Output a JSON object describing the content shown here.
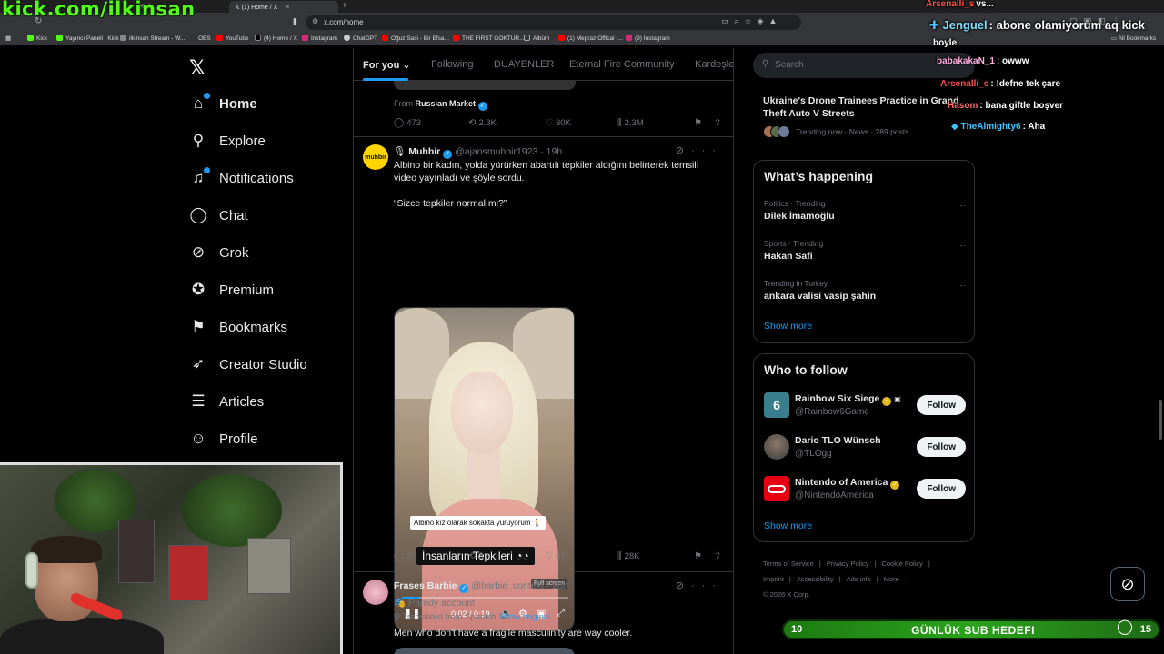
{
  "stream": {
    "banner": "kick.com/ilkinsan",
    "chat": [
      {
        "user": "Arsenalli_s",
        "message": "vs...",
        "color": "#ff4d4d"
      },
      {
        "user": "Jenguel",
        "message": "abone olamiyorum aq kick",
        "color": "#7fe0ff"
      },
      {
        "user": "",
        "message": "boyle",
        "color": "#ffffff"
      },
      {
        "user": "babakakaN_1",
        "message": "owww",
        "color": "#ffb0e0"
      },
      {
        "user": "Arsenalli_s",
        "message": "!defne tek çare",
        "color": "#ff4d4d"
      },
      {
        "user": "Hasom",
        "message": "bana giftle boşver",
        "color": "#ff6b6b"
      },
      {
        "user": "TheAlmighty6",
        "message": "Aha",
        "color": "#3fc6ff"
      }
    ],
    "goal": {
      "left": "10",
      "label": "GÜNLÜK SUB HEDEFI",
      "right": "15",
      "progress": 0.67
    }
  },
  "browser": {
    "tabs": [
      {
        "label": "Kick",
        "active": false
      },
      {
        "label": "(1) Home / X",
        "active": true
      }
    ],
    "url": "x.com/home",
    "bookmarks": [
      "Kick",
      "Yayıncı Paneli | Kick",
      "ilkinsan Stream - W...",
      "OBS",
      "YouTube",
      "(4) Home / X",
      "Instagram",
      "ChatGPT",
      "Oğuz Sasi - Bir Efsa...",
      "THE FIRST GOKTUR...",
      "Albüm",
      "(1) Mepraz Offical -...",
      "(9) Instagram"
    ],
    "all_bookmarks": "All Bookmarks"
  },
  "nav": {
    "items": [
      {
        "label": "Home",
        "icon": "home-icon"
      },
      {
        "label": "Explore",
        "icon": "search-icon"
      },
      {
        "label": "Notifications",
        "icon": "bell-icon"
      },
      {
        "label": "Chat",
        "icon": "chat-icon"
      },
      {
        "label": "Grok",
        "icon": "grok-icon"
      },
      {
        "label": "Premium",
        "icon": "verified-badge-icon"
      },
      {
        "label": "Bookmarks",
        "icon": "bookmark-icon"
      },
      {
        "label": "Creator Studio",
        "icon": "rocket-icon"
      },
      {
        "label": "Articles",
        "icon": "articles-icon"
      },
      {
        "label": "Profile",
        "icon": "person-icon"
      }
    ]
  },
  "timeline": {
    "tabs": [
      "For you",
      "Following",
      "DUAYENLER",
      "Eternal Fire Community",
      "Kardeşle"
    ],
    "prev_post": {
      "from_label": "From",
      "from_name": "Russian Market",
      "actions": {
        "replies": "473",
        "reposts": "2.3K",
        "likes": "30K",
        "views": "2.3M"
      }
    },
    "post1": {
      "name": "Muhbir",
      "handle": "@ajansmuhbir1923",
      "time": "19h",
      "avatar_text": "muhbir",
      "text1": "Albino bir kadın, yolda yürürken abartılı tepkiler aldığını belirterek temsili video yayınladı ve şöyle sordu.",
      "text2": "“Sizce tepkiler normal mi?”",
      "video": {
        "caption1": "Albino kız olarak sokakta yürüyorum",
        "caption2": "İnsanların Tepkileri",
        "fullscreen_tip": "Full screen",
        "time": "0:02 / 0:19",
        "progress": 0.105
      },
      "actions": {
        "replies": "37",
        "reposts": "3",
        "likes": "37",
        "views": "28K"
      }
    },
    "post2": {
      "name": "Frases Barbie",
      "handle": "@barbie_context",
      "time": "20h",
      "parody": "Parody account",
      "translated": "Translated from Spanish",
      "show_original": "Show original",
      "text": "Men who don't have a fragile masculinity are way cooler."
    }
  },
  "sidebar": {
    "search_placeholder": "Search",
    "top_trend": {
      "title": "Ukraine's Drone Trainees Practice in Grand Theft Auto V Streets",
      "meta": "Trending now · News · 289 posts"
    },
    "happening": {
      "title": "What’s happening",
      "trends": [
        {
          "category": "Politics · Trending",
          "name": "Dilek İmamoğlu"
        },
        {
          "category": "Sports · Trending",
          "name": "Hakan Safi"
        },
        {
          "category": "Trending in Turkey",
          "name": "ankara valisi vasip şahin"
        }
      ],
      "show_more": "Show more"
    },
    "who_to_follow": {
      "title": "Who to follow",
      "accounts": [
        {
          "name": "Rainbow Six Siege",
          "handle": "@Rainbow6Game",
          "button": "Follow",
          "avatar_color": "#3a7d8c"
        },
        {
          "name": "Dario TLO Wünsch",
          "handle": "@TLOgg",
          "button": "Follow",
          "avatar_color": "#6b6b6b"
        },
        {
          "name": "Nintendo of America",
          "handle": "@NintendoAmerica",
          "button": "Follow",
          "avatar_color": "#e60012"
        }
      ],
      "show_more": "Show more"
    },
    "footer": [
      "Terms of Service",
      "|",
      "Privacy Policy",
      "|",
      "Cookie Policy",
      "|",
      "Imprint",
      "|",
      "Accessibility",
      "|",
      "Ads info",
      "|",
      "More ···",
      "© 2026 X Corp."
    ]
  },
  "colors": {
    "accent": "#1d9bf0",
    "kick_green": "#53fc18",
    "background": "#000000"
  }
}
